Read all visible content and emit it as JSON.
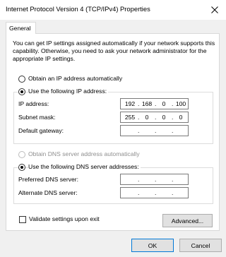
{
  "window": {
    "title": "Internet Protocol Version 4 (TCP/IPv4) Properties"
  },
  "tabs": [
    {
      "label": "General"
    }
  ],
  "general": {
    "description": "You can get IP settings assigned automatically if your network supports this capability. Otherwise, you need to ask your network administrator for the appropriate IP settings.",
    "ip_mode": {
      "auto_label": "Obtain an IP address automatically",
      "manual_label": "Use the following IP address:",
      "selected": "manual"
    },
    "ip_fields": [
      {
        "label": "IP address:",
        "octets": [
          "192",
          "168",
          "0",
          "100"
        ]
      },
      {
        "label": "Subnet mask:",
        "octets": [
          "255",
          "0",
          "0",
          "0"
        ]
      },
      {
        "label": "Default gateway:",
        "octets": [
          "",
          "",
          "",
          ""
        ]
      }
    ],
    "dns_mode": {
      "auto_label": "Obtain DNS server address automatically",
      "manual_label": "Use the following DNS server addresses:",
      "selected": "manual"
    },
    "dns_fields": [
      {
        "label": "Preferred DNS server:",
        "octets": [
          "",
          "",
          "",
          ""
        ]
      },
      {
        "label": "Alternate DNS server:",
        "octets": [
          "",
          "",
          "",
          ""
        ]
      }
    ],
    "validate_label": "Validate settings upon exit",
    "validate_checked": false,
    "advanced_label": "Advanced..."
  },
  "footer": {
    "ok_label": "OK",
    "cancel_label": "Cancel"
  },
  "colors": {
    "focus_border": "#0078d7",
    "disabled_text": "#8f8f8f"
  }
}
